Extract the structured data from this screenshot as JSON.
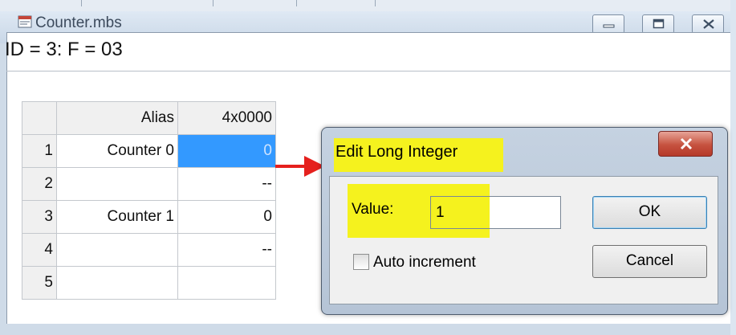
{
  "window": {
    "title": "Counter.mbs",
    "id_line": "ID = 3: F = 03"
  },
  "grid": {
    "headers": [
      "Alias",
      "4x0000"
    ],
    "rows": [
      {
        "num": "1",
        "alias": "Counter 0",
        "value": "0"
      },
      {
        "num": "2",
        "alias": "",
        "value": "--"
      },
      {
        "num": "3",
        "alias": "Counter 1",
        "value": "0"
      },
      {
        "num": "4",
        "alias": "",
        "value": "--"
      },
      {
        "num": "5",
        "alias": "",
        "value": ""
      }
    ]
  },
  "dialog": {
    "title": "Edit Long Integer",
    "value_label": "Value:",
    "value": "1",
    "ok_label": "OK",
    "cancel_label": "Cancel",
    "checkbox_label": "Auto increment"
  },
  "colors": {
    "highlight": "#f5f21e",
    "selection": "#3399ff",
    "arrow": "#e5201d"
  }
}
